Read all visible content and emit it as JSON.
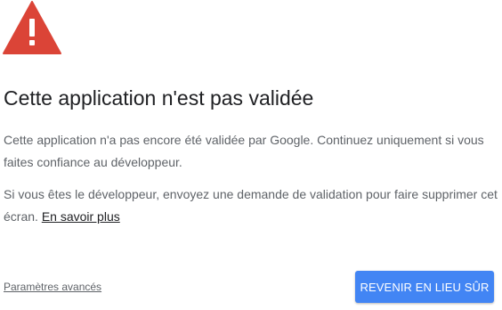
{
  "icon": {
    "name": "warning-icon",
    "color": "#db4437"
  },
  "title": "Cette application n'est pas validée",
  "paragraph1": "Cette application n'a pas encore été validée par Google. Continuez uniquement si vous faites confiance au développeur.",
  "paragraph2": {
    "text": "Si vous êtes le développeur, envoyez une demande de validation pour faire supprimer cet écran. ",
    "link_label": "En savoir plus"
  },
  "advanced_link_label": "Paramètres avancés",
  "back_button_label": "REVENIR EN LIEU SÛR",
  "colors": {
    "accent": "#4285f4",
    "warning": "#db4437",
    "title_text": "#202124",
    "body_text": "#5f6368"
  }
}
